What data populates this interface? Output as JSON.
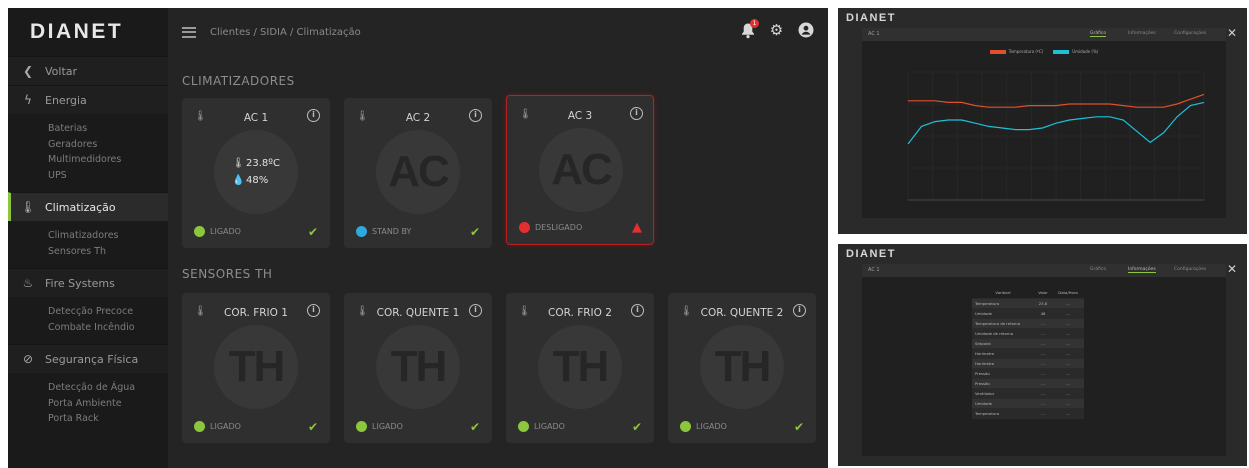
{
  "main": {
    "brand": "DIANET",
    "breadcrumb": "Clientes / SIDIA / Climatização",
    "notification_count": "1",
    "sidebar": {
      "back": "Voltar",
      "groups": [
        {
          "label": "Energia",
          "icon": "bolt-icon",
          "items": [
            "Baterias",
            "Geradores",
            "Multimedidores",
            "UPS"
          ]
        },
        {
          "label": "Climatização",
          "icon": "thermometer-icon",
          "active": true,
          "items": [
            "Climatizadores",
            "Sensores Th"
          ]
        },
        {
          "label": "Fire Systems",
          "icon": "fire-icon",
          "items": [
            "Detecção Precoce",
            "Combate Incêndio"
          ]
        },
        {
          "label": "Segurança Física",
          "icon": "shield-check-icon",
          "items": [
            "Detecção de Água",
            "Porta Ambiente",
            "Porta Rack"
          ]
        }
      ]
    },
    "sections": {
      "climatizadores": "CLIMATIZADORES",
      "sensores": "SENSORES TH"
    },
    "ac_cards": [
      {
        "title": "AC 1",
        "temperature": "23.8ºC",
        "humidity": "48%",
        "status": "LIGADO",
        "status_color": "#8cc63f",
        "state": "ok"
      },
      {
        "title": "AC 2",
        "placeholder": "AC",
        "status": "STAND BY",
        "status_color": "#2ea8e0",
        "state": "ok"
      },
      {
        "title": "AC 3",
        "placeholder": "AC",
        "status": "DESLIGADO",
        "status_color": "#e23030",
        "state": "alert"
      }
    ],
    "th_cards": [
      {
        "title": "COR. FRIO 1",
        "placeholder": "TH",
        "status": "LIGADO",
        "status_color": "#8cc63f"
      },
      {
        "title": "COR. QUENTE 1",
        "placeholder": "TH",
        "status": "LIGADO",
        "status_color": "#8cc63f"
      },
      {
        "title": "COR. FRIO 2",
        "placeholder": "TH",
        "status": "LIGADO",
        "status_color": "#8cc63f"
      },
      {
        "title": "COR. QUENTE 2",
        "placeholder": "TH",
        "status": "LIGADO",
        "status_color": "#8cc63f"
      }
    ],
    "accent": "#8cc63f"
  },
  "chart_window": {
    "brand": "DIANET",
    "title": "AC 1",
    "tabs": [
      "Gráfico",
      "Informações",
      "Configurações"
    ],
    "legend": [
      {
        "name": "Temperatura (ºC)",
        "color": "#e0502a"
      },
      {
        "name": "Umidade (%)",
        "color": "#1ec0d8"
      }
    ]
  },
  "chart_data": {
    "type": "line",
    "title": "",
    "xlabel": "",
    "ylabel": "",
    "x": [
      0,
      1,
      2,
      3,
      4,
      5,
      6,
      7,
      8,
      9,
      10,
      11,
      12,
      13,
      14,
      15,
      16,
      17,
      18,
      19,
      20,
      21,
      22
    ],
    "series": [
      {
        "name": "Temperatura (ºC)",
        "color": "#e0502a",
        "values": [
          24.2,
          24.2,
          24.2,
          24.1,
          24.1,
          23.9,
          23.8,
          23.8,
          23.8,
          23.9,
          23.9,
          23.9,
          24.0,
          24.0,
          24.0,
          24.0,
          23.9,
          23.8,
          23.8,
          23.8,
          24.0,
          24.3,
          24.6
        ]
      },
      {
        "name": "Umidade (%)",
        "color": "#1ec0d8",
        "values": [
          21.5,
          22.6,
          22.9,
          23.0,
          23.0,
          22.8,
          22.6,
          22.5,
          22.4,
          22.4,
          22.5,
          22.8,
          23.0,
          23.1,
          23.2,
          23.2,
          23.0,
          22.3,
          21.6,
          22.2,
          23.2,
          23.9,
          24.1
        ]
      }
    ],
    "ylim": [
      18,
      26
    ],
    "grid": true,
    "legend_position": "top-center"
  },
  "table_window": {
    "brand": "DIANET",
    "title": "AC 1",
    "tabs": [
      "Gráfico",
      "Informações",
      "Configurações"
    ],
    "columns": [
      "Variável",
      "Valor",
      "Data/Hora"
    ],
    "rows": [
      [
        "Temperatura",
        "23.8",
        "..."
      ],
      [
        "Umidade",
        "48",
        "..."
      ],
      [
        "Temperatura de retorno",
        "...",
        "..."
      ],
      [
        "Umidade de retorno",
        "...",
        "..."
      ],
      [
        "Setpoint",
        "...",
        "..."
      ],
      [
        "Horímetro",
        "...",
        "..."
      ],
      [
        "Horímetro",
        "...",
        "..."
      ],
      [
        "Pressão",
        "...",
        "..."
      ],
      [
        "Pressão",
        "...",
        "..."
      ],
      [
        "Ventilador",
        "...",
        "..."
      ],
      [
        "Umidade",
        "...",
        "..."
      ],
      [
        "Temperatura",
        "...",
        "..."
      ]
    ]
  }
}
